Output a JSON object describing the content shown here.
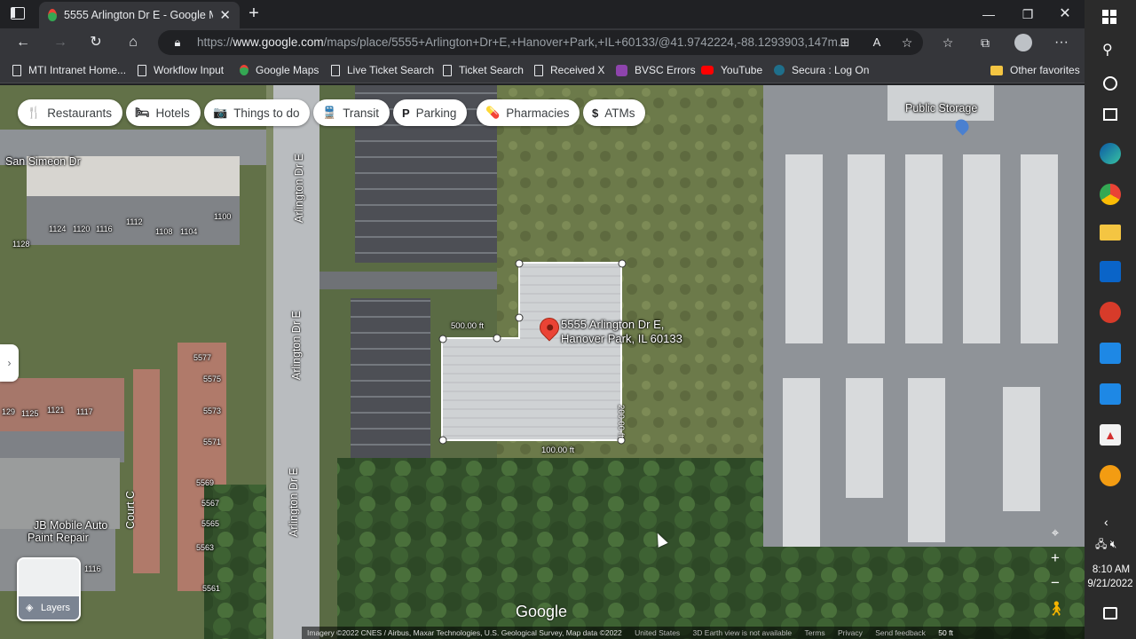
{
  "browser": {
    "tab_title": "5555 Arlington Dr E - Google Ma",
    "url_prefix": "https://",
    "url_host": "www.google.com",
    "url_path": "/maps/place/5555+Arlington+Dr+E,+Hanover+Park,+IL+60133/@41.9742224,-88.1293903,147m..."
  },
  "bookmarks": [
    {
      "label": "MTI Intranet Home..."
    },
    {
      "label": "Workflow Input"
    },
    {
      "label": "Google Maps"
    },
    {
      "label": "Live Ticket Search"
    },
    {
      "label": "Ticket Search"
    },
    {
      "label": "Received X"
    },
    {
      "label": "BVSC Errors"
    },
    {
      "label": "YouTube"
    },
    {
      "label": "Secura : Log On"
    },
    {
      "label": "Other favorites"
    }
  ],
  "map": {
    "chips": [
      {
        "label": "Restaurants",
        "icon": "🍴"
      },
      {
        "label": "Hotels",
        "icon": "🛏"
      },
      {
        "label": "Things to do",
        "icon": "📷"
      },
      {
        "label": "Transit",
        "icon": "🚆"
      },
      {
        "label": "Parking",
        "icon": "P"
      },
      {
        "label": "Pharmacies",
        "icon": "💊"
      },
      {
        "label": "ATMs",
        "icon": "$"
      }
    ],
    "place_name_line1": "5555 Arlington Dr E,",
    "place_name_line2": "Hanover Park, IL 60133",
    "poi_public_storage": "Public Storage",
    "poi_jb_mobile_line1": "JB Mobile Auto",
    "poi_jb_mobile_line2": "Paint Repair",
    "street_san_simeon": "San Simeon Dr",
    "street_arlington_1": "Arlington Dr E",
    "street_arlington_2": "Arlington Dr E",
    "street_arlington_3": "Arlington Dr E",
    "street_court": "Court C",
    "measure_500": "500.00 ft",
    "measure_200": "200.00 ft",
    "measure_100": "100.00 ft",
    "building_numbers": [
      "1124",
      "1120",
      "1116",
      "1112",
      "1108",
      "1104",
      "1100",
      "1128",
      "129",
      "1125",
      "1121",
      "1117",
      "5577",
      "5575",
      "5573",
      "5571",
      "5569",
      "5567",
      "5565",
      "5563",
      "5561",
      "1116"
    ],
    "layers_label": "Layers",
    "google_logo": "Google",
    "attribution": "Imagery ©2022 CNES / Airbus, Maxar Technologies, U.S. Geological Survey, Map data ©2022",
    "attrib_country": "United States",
    "attrib_3d": "3D Earth view is not available",
    "attrib_terms": "Terms",
    "attrib_privacy": "Privacy",
    "attrib_feedback": "Send feedback",
    "scale_label": "50 ft"
  },
  "taskbar": {
    "time": "8:10 AM",
    "date": "9/21/2022"
  },
  "colors": {
    "marker": "#ea4335",
    "chrome_dark": "#202124",
    "chrome_mid": "#35363a"
  }
}
